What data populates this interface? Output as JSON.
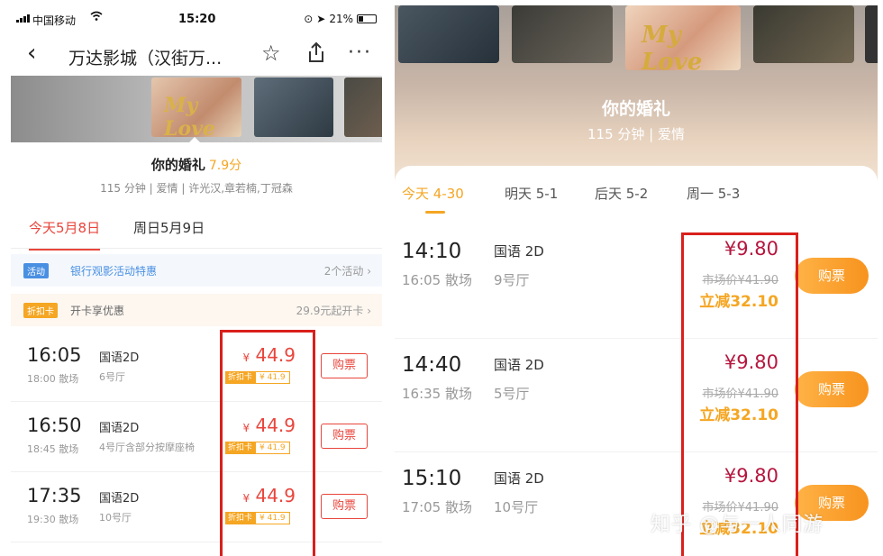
{
  "left": {
    "status": {
      "carrier": "中国移动",
      "time": "15:20",
      "battery": "21%"
    },
    "nav": {
      "back_icon": "‹",
      "title": "万达影城（汉街万...",
      "star_icon": "☆",
      "more_icon": "···"
    },
    "movie": {
      "title": "你的婚礼",
      "score": "7.9分",
      "meta": "115 分钟 | 爱情 | 许光汉,章若楠,丁冠森"
    },
    "date_tabs": [
      {
        "label": "今天5月8日"
      },
      {
        "label": "周日5月9日"
      }
    ],
    "promos": [
      {
        "tag": "活动",
        "text": "银行观影活动特惠",
        "more": "2个活动 ›"
      },
      {
        "tag": "折扣卡",
        "text": "开卡享优惠",
        "more": "29.9元起开卡 ›"
      }
    ],
    "showtimes": [
      {
        "start": "16:05",
        "end": "18:00 散场",
        "lang": "国语2D",
        "hall": "6号厅",
        "price": "44.9",
        "currency": "¥",
        "card_label": "折扣卡",
        "card_price": "¥ 41.9",
        "buy": "购票"
      },
      {
        "start": "16:50",
        "end": "18:45 散场",
        "lang": "国语2D",
        "hall": "4号厅含部分按摩座椅",
        "price": "44.9",
        "currency": "¥",
        "card_label": "折扣卡",
        "card_price": "¥ 41.9",
        "buy": "购票"
      },
      {
        "start": "17:35",
        "end": "19:30 散场",
        "lang": "国语2D",
        "hall": "10号厅",
        "price": "44.9",
        "currency": "¥",
        "card_label": "折扣卡",
        "card_price": "¥ 41.9",
        "buy": "购票"
      }
    ]
  },
  "right": {
    "movie": {
      "title": "你的婚礼",
      "meta": "115 分钟 | 爱情"
    },
    "date_tabs": [
      {
        "label": "今天 4-30"
      },
      {
        "label": "明天 5-1"
      },
      {
        "label": "后天 5-2"
      },
      {
        "label": "周一 5-3"
      }
    ],
    "showtimes": [
      {
        "start": "14:10",
        "end": "16:05 散场",
        "lang": "国语 2D",
        "hall": "9号厅",
        "price": "¥9.80",
        "orig": "市场价¥41.90",
        "save": "立减32.10",
        "buy": "购票"
      },
      {
        "start": "14:40",
        "end": "16:35 散场",
        "lang": "国语 2D",
        "hall": "5号厅",
        "price": "¥9.80",
        "orig": "市场价¥41.90",
        "save": "立减32.10",
        "buy": "购票"
      },
      {
        "start": "15:10",
        "end": "17:05 散场",
        "lang": "国语 2D",
        "hall": "10号厅",
        "price": "¥9.80",
        "orig": "市场价¥41.90",
        "save": "立减32.10",
        "buy": "购票"
      }
    ]
  },
  "watermark": "知乎 @与一人同游"
}
